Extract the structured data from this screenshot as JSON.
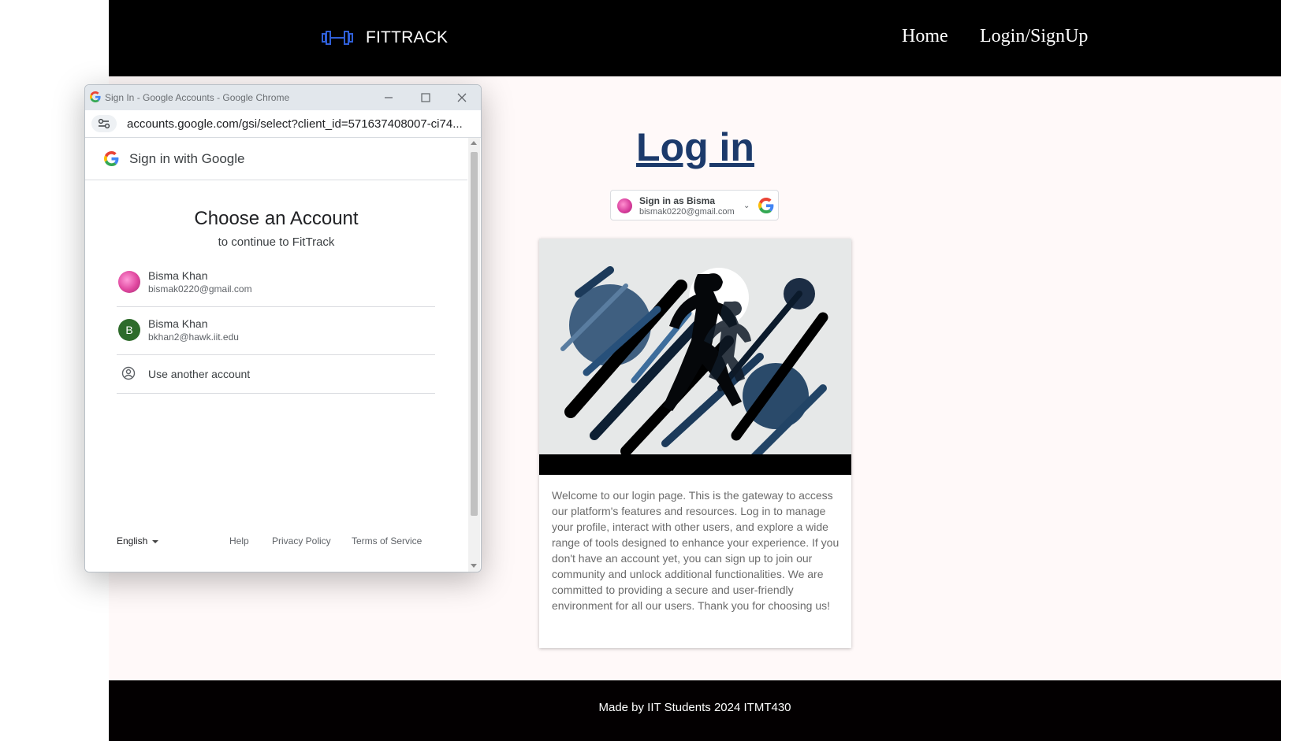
{
  "site": {
    "brand": "FITTRACK",
    "nav": {
      "home": "Home",
      "login": "Login/SignUp"
    },
    "page_title": "Log in",
    "google_button": {
      "line1": "Sign in as Bisma",
      "line2": "bismak0220@gmail.com"
    },
    "card_text": "Welcome to our login page. This is the gateway to access our platform's features and resources. Log in to manage your profile, interact with other users, and explore a wide range of tools designed to enhance your experience. If you don't have an account yet, you can sign up to join our community and unlock additional functionalities. We are committed to providing a secure and user-friendly environment for all our users. Thank you for choosing us!",
    "footer": "Made by IIT Students 2024 ITMT430"
  },
  "popup": {
    "window_title": "Sign In - Google Accounts - Google Chrome",
    "url": "accounts.google.com/gsi/select?client_id=571637408007-ci74...",
    "header": "Sign in with Google",
    "choose": "Choose an Account",
    "continue": "to continue to FitTrack",
    "accounts": [
      {
        "name": "Bisma Khan",
        "email": "bismak0220@gmail.com"
      },
      {
        "name": "Bisma Khan",
        "email": "bkhan2@hawk.iit.edu",
        "initial": "B"
      }
    ],
    "another": "Use another account",
    "language": "English",
    "links": {
      "help": "Help",
      "privacy": "Privacy Policy",
      "terms": "Terms of Service"
    }
  },
  "colors": {
    "nav_bg": "#000000",
    "title_link": "#1c3a6b",
    "brand_icon": "#2f5fd8",
    "avatar_initial_bg": "#2e6b2b"
  }
}
